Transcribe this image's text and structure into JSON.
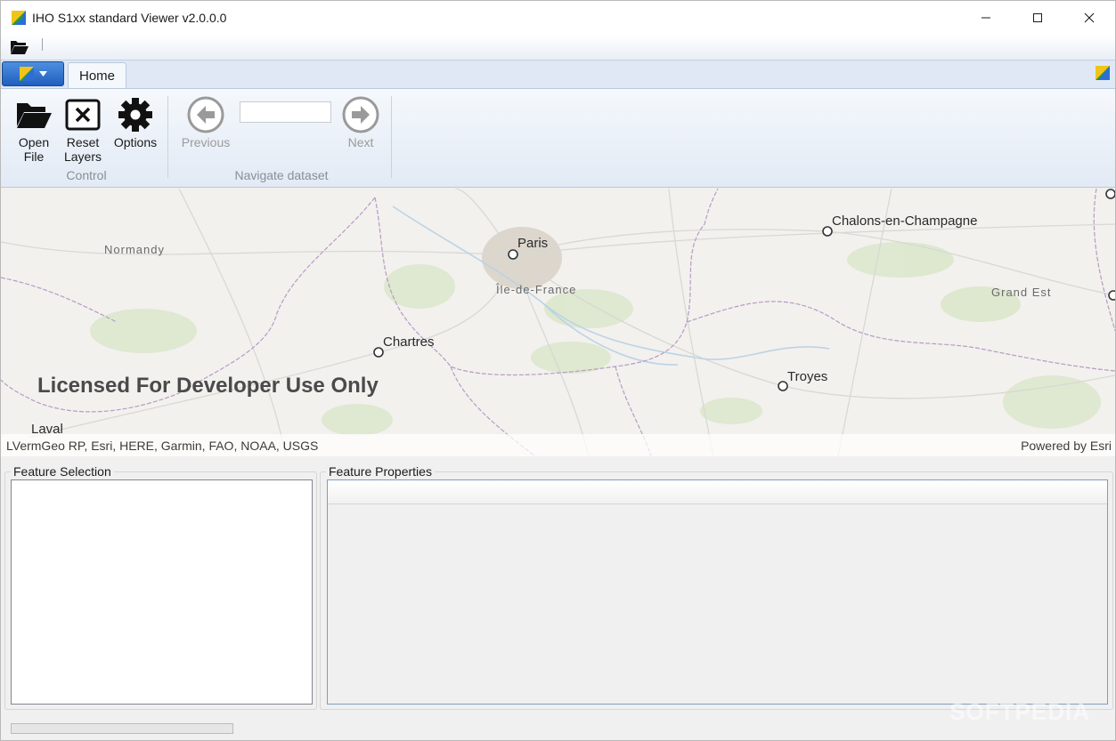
{
  "window": {
    "title": "IHO S1xx standard Viewer v2.0.0.0",
    "controls": {
      "minimize": "minimize-icon",
      "maximize": "maximize-icon",
      "close": "close-icon"
    }
  },
  "ribbon": {
    "tabs": [
      {
        "label": "Home"
      }
    ],
    "groups": {
      "control": {
        "label": "Control",
        "buttons": {
          "open_file": "Open File",
          "open_file_line1": "Open",
          "open_file_line2": "File",
          "reset_line1": "Reset",
          "reset_line2": "Layers",
          "options": "Options"
        }
      },
      "navigate": {
        "label": "Navigate dataset",
        "previous": "Previous",
        "next": "Next",
        "input_value": ""
      }
    }
  },
  "map": {
    "places": {
      "paris": "Paris",
      "chartres": "Chartres",
      "troyes": "Troyes",
      "chalons": "Chalons-en-Champagne",
      "laval": "Laval"
    },
    "regions": {
      "normandy": "Normandy",
      "idf": "Île-de-France",
      "grand_est": "Grand Est"
    },
    "license_text": "Licensed For Developer Use Only",
    "attribution_left": "LVermGeo RP, Esri, HERE, Garmin, FAO, NOAA, USGS",
    "attribution_right": "Powered by Esri"
  },
  "panels": {
    "feature_selection": "Feature Selection",
    "feature_properties": "Feature Properties"
  },
  "status": {
    "progress": 0
  },
  "watermark": "SOFTPEDIA",
  "colors": {
    "app_menu_blue": "#2a6acb",
    "ribbon_bg": "#e2eaf5",
    "map_bg": "#f2f1ee",
    "boundary": "#b69bc4"
  }
}
